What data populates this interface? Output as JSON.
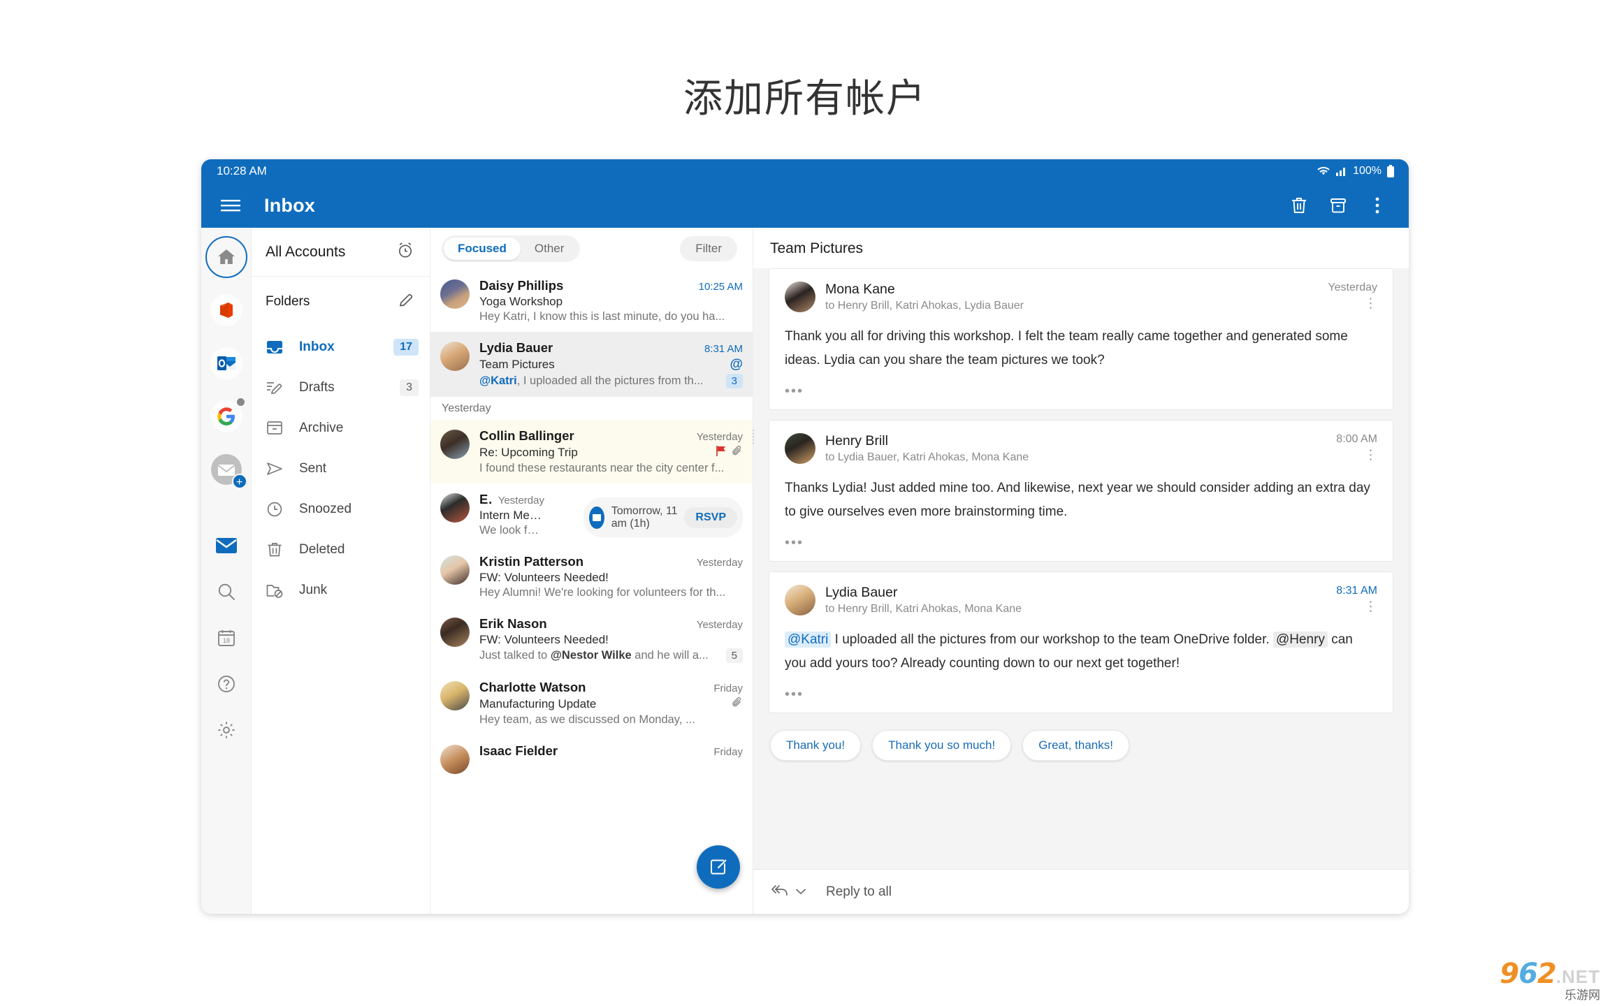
{
  "headline": "添加所有帐户",
  "status_bar": {
    "time": "10:28 AM",
    "battery": "100%"
  },
  "app_bar": {
    "title": "Inbox",
    "menu_icon": "hamburger-icon",
    "actions": [
      "delete-icon",
      "archive-icon",
      "more-vertical-icon"
    ]
  },
  "rail": {
    "accounts": [
      {
        "name": "home",
        "label": "Home",
        "selected": true
      },
      {
        "name": "office",
        "label": "Office",
        "selected": false
      },
      {
        "name": "outlook",
        "label": "Outlook",
        "selected": false
      },
      {
        "name": "google",
        "label": "Google",
        "selected": false,
        "badge": true
      },
      {
        "name": "add-account",
        "label": "Add account",
        "selected": false
      }
    ],
    "tools": [
      {
        "name": "mail",
        "label": "Mail",
        "selected": true
      },
      {
        "name": "search",
        "label": "Search",
        "selected": false
      },
      {
        "name": "calendar",
        "label": "Calendar",
        "day": "18",
        "selected": false
      },
      {
        "name": "help",
        "label": "Help",
        "selected": false
      },
      {
        "name": "settings",
        "label": "Settings",
        "selected": false
      }
    ]
  },
  "folders_pane": {
    "all_accounts_label": "All Accounts",
    "alarm_icon": "alarm-clock-icon",
    "folders_label": "Folders",
    "edit_icon": "pencil-icon",
    "items": [
      {
        "label": "Inbox",
        "count": "17",
        "icon": "inbox-icon",
        "active": true
      },
      {
        "label": "Drafts",
        "count": "3",
        "icon": "drafts-icon",
        "active": false
      },
      {
        "label": "Archive",
        "count": "",
        "icon": "archive-icon",
        "active": false
      },
      {
        "label": "Sent",
        "count": "",
        "icon": "sent-icon",
        "active": false
      },
      {
        "label": "Snoozed",
        "count": "",
        "icon": "clock-icon",
        "active": false
      },
      {
        "label": "Deleted",
        "count": "",
        "icon": "trash-icon",
        "active": false
      },
      {
        "label": "Junk",
        "count": "",
        "icon": "junk-icon",
        "active": false
      }
    ]
  },
  "message_list": {
    "tabs": [
      {
        "label": "Focused",
        "active": true
      },
      {
        "label": "Other",
        "active": false
      }
    ],
    "filter_label": "Filter",
    "section_label": "Yesterday",
    "compose_icon": "compose-icon",
    "messages": [
      {
        "sender": "Daisy Phillips",
        "time": "10:25 AM",
        "subject": "Yoga Workshop",
        "preview": "Hey Katri, I know this is last minute, do you ha...",
        "selected": false,
        "flagged": false
      },
      {
        "sender": "Lydia Bauer",
        "time": "8:31 AM",
        "subject": "Team Pictures",
        "preview_mention": "@Katri",
        "preview": ", I uploaded all the pictures from th...",
        "count": "3",
        "mention_icon": "at-mention-icon",
        "selected": true,
        "flagged": false
      },
      {
        "sender": "Collin Ballinger",
        "time": "Yesterday",
        "subject": "Re: Upcoming Trip",
        "preview": "I found these restaurants near the city center f...",
        "selected": false,
        "flagged": true,
        "attachment": true
      },
      {
        "sender": "Elvia Atkins",
        "time": "Yesterday",
        "subject": "Intern Meet & Greet",
        "preview": "We look forward to welcoming our fall interns t...",
        "selected": false,
        "flagged": false,
        "rsvp": {
          "text": "Tomorrow, 11 am (1h)",
          "button": "RSVP",
          "icon": "calendar-event-icon"
        }
      },
      {
        "sender": "Kristin Patterson",
        "time": "Yesterday",
        "subject": "FW: Volunteers Needed!",
        "preview": "Hey Alumni! We're looking for volunteers for th...",
        "selected": false,
        "flagged": false
      },
      {
        "sender": "Erik Nason",
        "time": "Yesterday",
        "subject": "FW: Volunteers Needed!",
        "preview_pre": "Just talked to ",
        "preview_bold": "@Nestor Wilke",
        "preview": " and he will a...",
        "count": "5",
        "selected": false,
        "flagged": false
      },
      {
        "sender": "Charlotte Watson",
        "time": "Friday",
        "subject": "Manufacturing Update",
        "preview": "Hey team, as we discussed on Monday, ...",
        "attachment": true,
        "selected": false,
        "flagged": false
      },
      {
        "sender": "Isaac Fielder",
        "time": "Friday",
        "subject": "",
        "preview": "",
        "selected": false,
        "flagged": false
      }
    ]
  },
  "reader": {
    "subject": "Team Pictures",
    "messages": [
      {
        "sender": "Mona Kane",
        "recipients": "to Henry Brill, Katri Ahokas, Lydia Bauer",
        "time": "Yesterday",
        "time_blue": false,
        "body": "Thank you all for driving this workshop. I felt the team really came together and generated some ideas. Lydia can you share the team pictures we took?",
        "expand_icon": "ellipsis-icon",
        "more_icon": "more-vertical-icon"
      },
      {
        "sender": "Henry Brill",
        "recipients": "to Lydia Bauer, Katri Ahokas, Mona Kane",
        "time": "8:00 AM",
        "time_blue": false,
        "body": "Thanks Lydia! Just added mine too. And likewise, next year we should consider adding an extra day to give ourselves even more brainstorming time.",
        "expand_icon": "ellipsis-icon",
        "more_icon": "more-vertical-icon"
      },
      {
        "sender": "Lydia Bauer",
        "recipients": "to Henry Brill, Katri Ahokas, Mona Kane",
        "time": "8:31 AM",
        "time_blue": true,
        "mention_1": "@Katri",
        "body_1": " I uploaded all the pictures from our workshop to the team OneDrive folder. ",
        "mention_2": "@Henry",
        "body_2": " can you add yours too? Already counting down to our next get together!",
        "expand_icon": "ellipsis-icon",
        "more_icon": "more-vertical-icon"
      }
    ],
    "suggestions": [
      "Thank you!",
      "Thank you so much!",
      "Great, thanks!"
    ],
    "reply_bar": {
      "label": "Reply to all",
      "icon": "reply-all-icon",
      "chevron": "chevron-down-icon"
    }
  },
  "android_nav": {
    "back_icon": "back-chevron-icon",
    "home_icon": "home-square-icon",
    "recents_icon": "recents-bars-icon"
  },
  "watermark": {
    "main": "962",
    "tld": ".NET",
    "sub": "乐游网"
  },
  "colors": {
    "brand": "#0f6cbd",
    "flagged_row": "#fdfbee",
    "selected_row": "#eeeeee"
  }
}
